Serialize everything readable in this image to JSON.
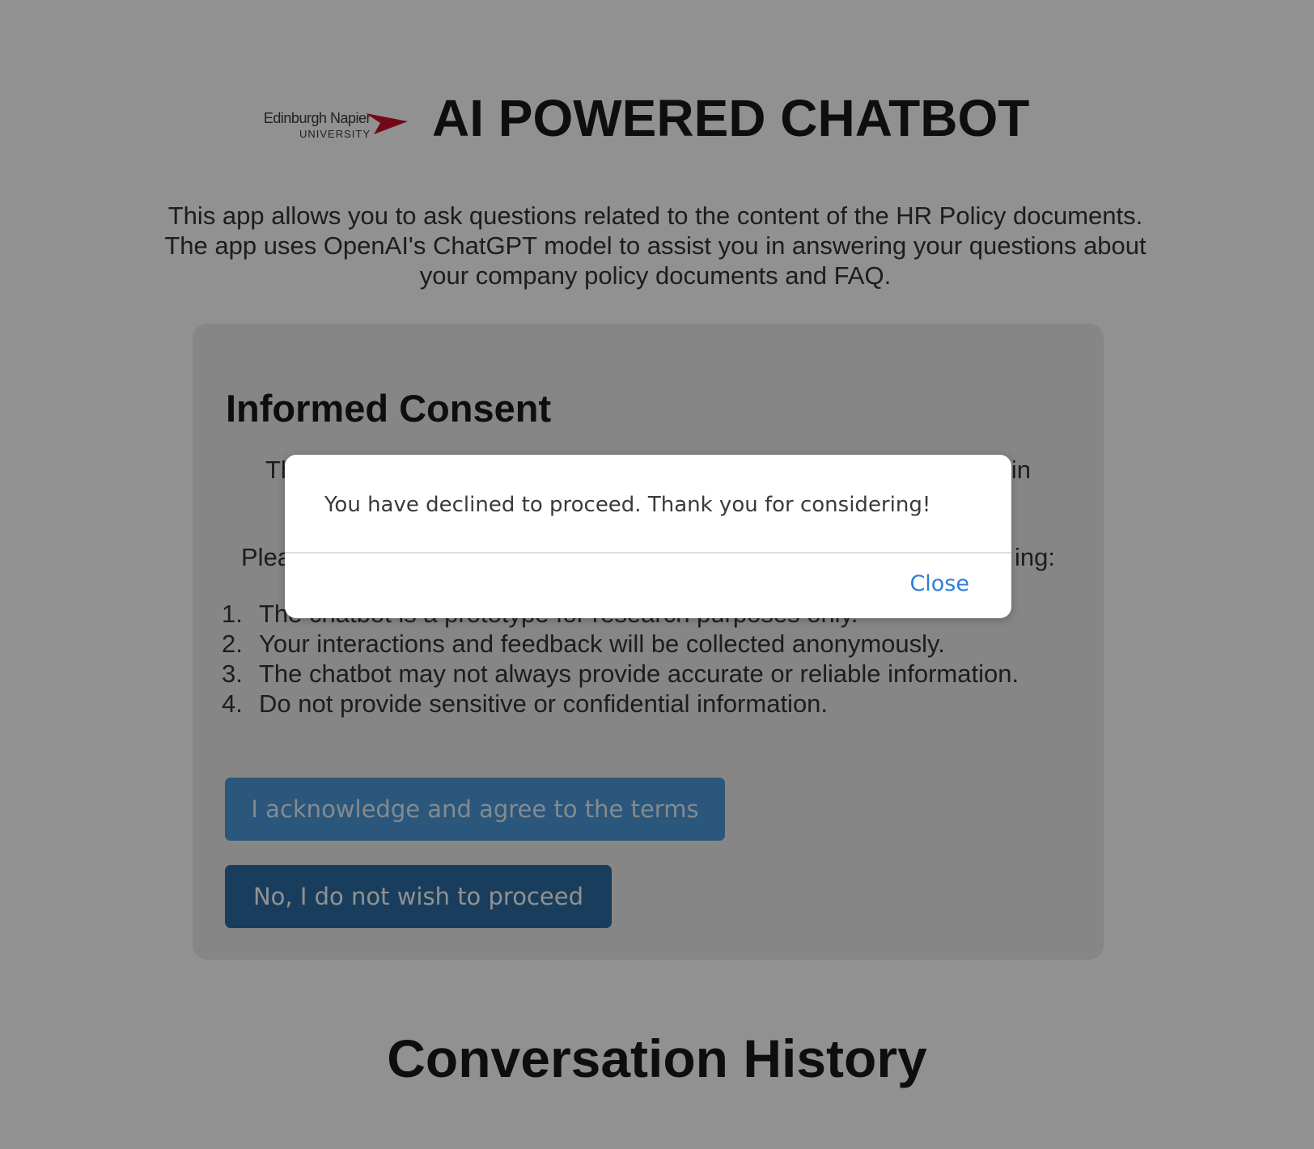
{
  "header": {
    "logo": {
      "name": "Edinburgh Napier",
      "subtitle": "UNIVERSITY",
      "mark_color": "#c8102e"
    },
    "title": "AI POWERED CHATBOT"
  },
  "intro": "This app allows you to ask questions related to the content of the HR Policy documents. The app uses OpenAI's ChatGPT model to assist you in answering your questions about your company policy documents and FAQ.",
  "consent": {
    "title": "Informed Consent",
    "intro_partial_left": "Th",
    "intro_partial_right": "in",
    "prompt_partial_left": "Plea",
    "prompt_partial_right": "ing:",
    "terms": [
      {
        "num": "1.",
        "text": "The chatbot is a prototype for research purposes only."
      },
      {
        "num": "2.",
        "text": "Your interactions and feedback will be collected anonymously."
      },
      {
        "num": "3.",
        "text": "The chatbot may not always provide accurate or reliable information."
      },
      {
        "num": "4.",
        "text": "Do not provide sensitive or confidential information."
      }
    ],
    "agree_button": "I acknowledge and agree to the terms",
    "decline_button": "No, I do not wish to proceed"
  },
  "history": {
    "title": "Conversation History"
  },
  "modal": {
    "message": "You have declined to proceed. Thank you for considering!",
    "close_button": "Close"
  },
  "colors": {
    "agree_button": "#4a9ad8",
    "decline_button": "#2d6ea4",
    "modal_link": "#2f7fd8",
    "card_background": "#ececec"
  }
}
